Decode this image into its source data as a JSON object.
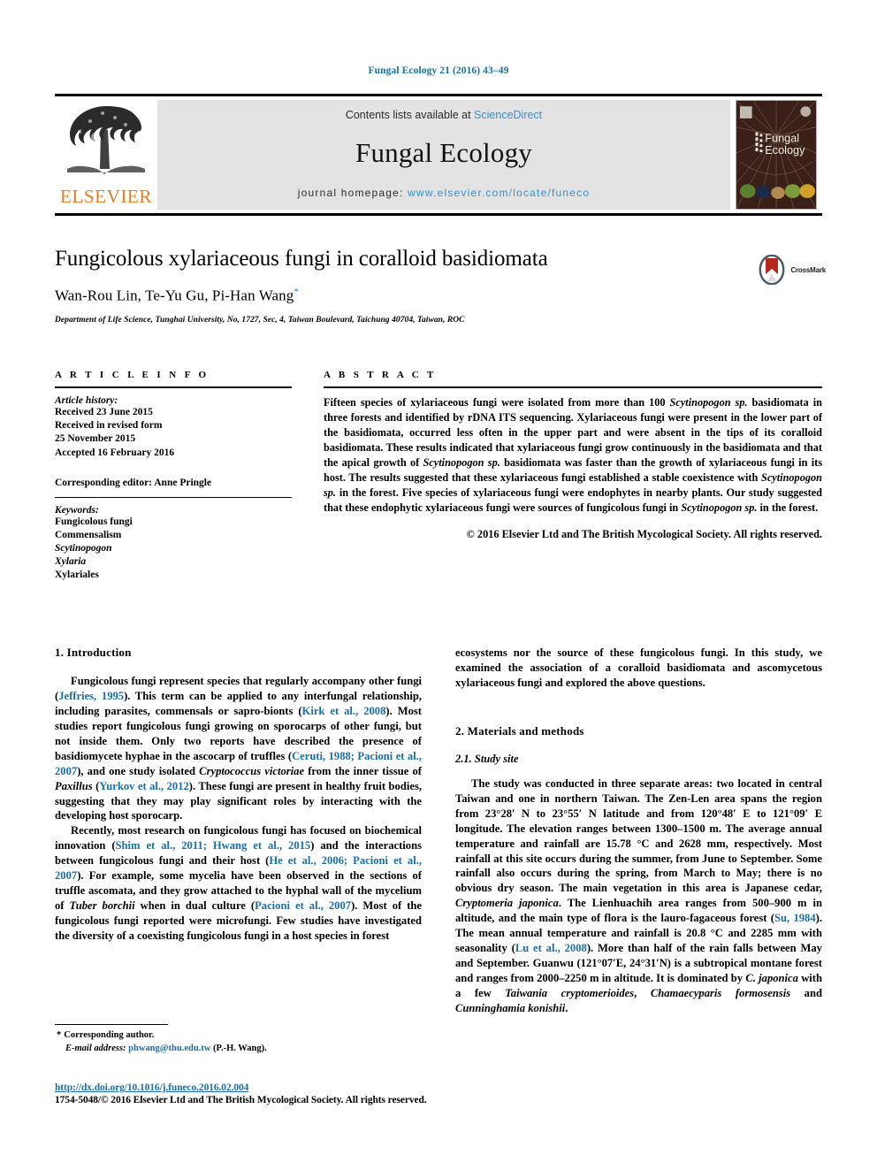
{
  "running_head": "Fungal Ecology 21 (2016) 43–49",
  "masthead": {
    "contents_prefix": "Contents lists available at ",
    "contents_link": "ScienceDirect",
    "journal_title": "Fungal Ecology",
    "homepage_prefix": "journal homepage: ",
    "homepage_url": "www.elsevier.com/locate/funeco",
    "publisher_wordmark": "ELSEVIER",
    "publisher_color": "#e87d1e",
    "link_color": "#3b8fc4",
    "cover_title_line1": "Fungal",
    "cover_title_line2": "Ecology"
  },
  "article": {
    "title": "Fungicolous xylariaceous fungi in coralloid basidiomata",
    "authors": "Wan-Rou Lin, Te-Yu Gu, Pi-Han Wang",
    "corresponding_marker": "*",
    "affiliation": "Department of Life Science, Tunghai University, No, 1727, Sec, 4, Taiwan Boulevard, Taichung 40704, Taiwan, ROC",
    "crossmark_label": "CrossMark"
  },
  "article_info": {
    "heading": "A R T I C L E   I N F O",
    "history_label": "Article history:",
    "history_lines": [
      "Received 23 June 2015",
      "Received in revised form",
      "25 November 2015",
      "Accepted 16 February 2016"
    ],
    "editor_line": "Corresponding editor: Anne Pringle",
    "keywords_label": "Keywords:",
    "keywords": [
      "Fungicolous fungi",
      "Commensalism",
      "Scytinopogon",
      "Xylaria",
      "Xylariales"
    ],
    "keywords_italic": [
      false,
      false,
      true,
      true,
      false
    ]
  },
  "abstract": {
    "heading": "A B S T R A C T",
    "paragraph": "Fifteen species of xylariaceous fungi were isolated from more than 100 Scytinopogon sp. basidiomata in three forests and identified by rDNA ITS sequencing. Xylariaceous fungi were present in the lower part of the basidiomata, occurred less often in the upper part and were absent in the tips of its coralloid basidiomata. These results indicated that xylariaceous fungi grow continuously in the basidiomata and that the apical growth of Scytinopogon sp. basidiomata was faster than the growth of xylariaceous fungi in its host. The results suggested that these xylariaceous fungi established a stable coexistence with Scytinopogon sp. in the forest. Five species of xylariaceous fungi were endophytes in nearby plants. Our study suggested that these endophytic xylariaceous fungi were sources of fungicolous fungi in Scytinopogon sp. in the forest.",
    "copyright": "© 2016 Elsevier Ltd and The British Mycological Society. All rights reserved."
  },
  "sections": {
    "intro_heading": "1.  Introduction",
    "intro_p1": "Fungicolous fungi represent species that regularly accompany other fungi (Jeffries, 1995). This term can be applied to any interfungal relationship, including parasites, commensals or sapro-bionts (Kirk et al., 2008). Most studies report fungicolous fungi growing on sporocarps of other fungi, but not inside them. Only two reports have described the presence of basidiomycete hyphae in the ascocarp of truffles (Ceruti, 1988; Pacioni et al., 2007), and one study isolated Cryptococcus victoriae from the inner tissue of Paxillus (Yurkov et al., 2012). These fungi are present in healthy fruit bodies, suggesting that they may play significant roles by interacting with the developing host sporocarp.",
    "intro_p2": "Recently, most research on fungicolous fungi has focused on biochemical innovation (Shim et al., 2011; Hwang et al., 2015) and the interactions between fungicolous fungi and their host (He et al., 2006; Pacioni et al., 2007). For example, some mycelia have been observed in the sections of truffle ascomata, and they grow attached to the hyphal wall of the mycelium of Tuber borchii when in dual culture (Pacioni et al., 2007). Most of the fungicolous fungi reported were microfungi. Few studies have investigated the diversity of a coexisting fungicolous fungi in a host species in forest",
    "right_p_continue": "ecosystems nor the source of these fungicolous fungi. In this study, we examined the association of a coralloid basidiomata and ascomycetous xylariaceous fungi and explored the above questions.",
    "methods_heading": "2.  Materials and methods",
    "study_site_heading": "2.1.  Study site",
    "study_site_p": "The study was conducted in three separate areas: two located in central Taiwan and one in northern Taiwan. The Zen-Len area spans the region from 23°28′ N to 23°55′ N latitude and from 120°48′ E to 121°09′ E longitude. The elevation ranges between 1300–1500 m. The average annual temperature and rainfall are 15.78 °C and 2628 mm, respectively. Most rainfall at this site occurs during the summer, from June to September. Some rainfall also occurs during the spring, from March to May; there is no obvious dry season. The main vegetation in this area is Japanese cedar, Cryptomeria japonica. The Lienhuachih area ranges from 500–900 m in altitude, and the main type of flora is the lauro-fagaceous forest (Su, 1984). The mean annual temperature and rainfall is 20.8 °C and 2285 mm with seasonality (Lu et al., 2008). More than half of the rain falls between May and September. Guanwu (121°07′E, 24°31′N) is a subtropical montane forest and ranges from 2000–2250 m in altitude. It is dominated by C. japonica with a few Taiwania cryptomerioides, Chamaecyparis formosensis and Cunninghamia konishii."
  },
  "footnote": {
    "marker": "*",
    "corresponding_text": "Corresponding author.",
    "email_label": "E-mail address:",
    "email": "phwang@thu.edu.tw",
    "email_suffix": "(P.-H. Wang)."
  },
  "footer": {
    "doi": "http://dx.doi.org/10.1016/j.funeco.2016.02.004",
    "issn_line": "1754-5048/© 2016 Elsevier Ltd and The British Mycological Society. All rights reserved."
  }
}
